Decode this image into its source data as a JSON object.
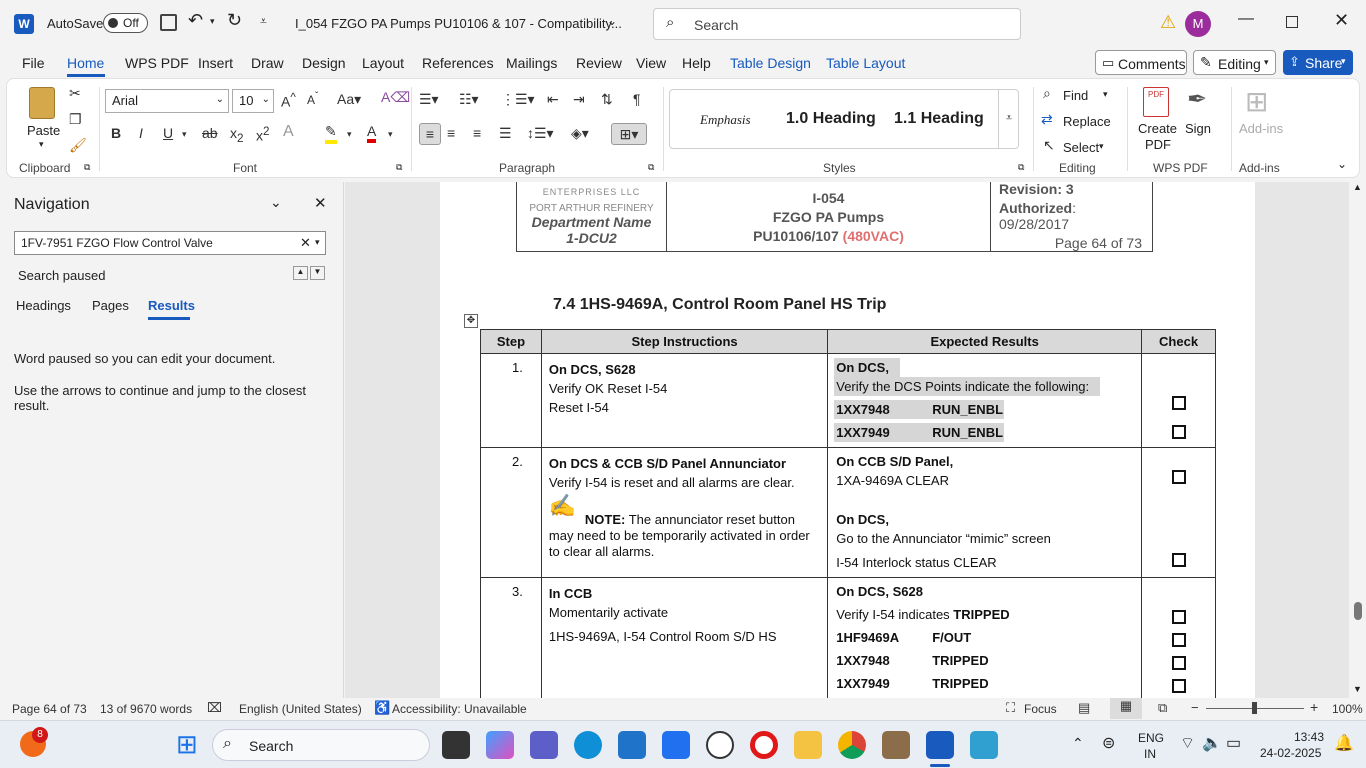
{
  "titlebar": {
    "autosave_label": "AutoSave",
    "autosave_state": "Off",
    "doc_title": "I_054 FZGO PA Pumps PU10106 & 107  -  Compatibility...",
    "search_placeholder": "Search",
    "avatar_letter": "M"
  },
  "tabs": [
    "File",
    "Home",
    "WPS PDF",
    "Insert",
    "Draw",
    "Design",
    "Layout",
    "References",
    "Mailings",
    "Review",
    "View",
    "Help",
    "Table Design",
    "Table Layout"
  ],
  "right_buttons": {
    "comments": "Comments",
    "editing": "Editing",
    "share": "Share"
  },
  "ribbon": {
    "clipboard": {
      "paste": "Paste",
      "group": "Clipboard"
    },
    "font": {
      "name": "Arial",
      "size": "10",
      "group": "Font"
    },
    "paragraph": {
      "group": "Paragraph"
    },
    "styles": {
      "group": "Styles",
      "items": [
        "Emphasis",
        "1.0  Heading",
        "1.1  Heading"
      ]
    },
    "editing": {
      "find": "Find",
      "replace": "Replace",
      "select": "Select",
      "group": "Editing"
    },
    "wps": {
      "create": "Create",
      "pdf": "PDF",
      "sign": "Sign",
      "group": "WPS PDF"
    },
    "addins": {
      "label": "Add-ins",
      "group": "Add-ins"
    }
  },
  "nav": {
    "title": "Navigation",
    "search_value": "1FV-7951 FZGO Flow Control Valve",
    "status": "Search paused",
    "tabs": [
      "Headings",
      "Pages",
      "Results"
    ],
    "msg1": "Word paused so you can edit your document.",
    "msg2": "Use the arrows to continue and jump to the closest result."
  },
  "doc": {
    "header": {
      "company": "ENTERPRISES LLC",
      "refinery": "PORT ARTHUR REFINERY",
      "dept": "Department Name",
      "unit": "1-DCU2",
      "doc_id": "I-054",
      "doc_name": "FZGO PA Pumps",
      "doc_pu": "PU10106/107",
      "doc_volt": "(480VAC)",
      "revision_label": "Revision:",
      "revision": "3",
      "auth_label": "Authorized",
      "auth_date": ": 09/28/2017",
      "page": "Page 64 of 73"
    },
    "section_title": "7.4  1HS-9469A, Control Room Panel HS Trip",
    "columns": [
      "Step",
      "Step Instructions",
      "Expected Results",
      "Check"
    ],
    "row1": {
      "num": "1.",
      "i1": "On DCS, S628",
      "i2": "Verify OK Reset I-54",
      "i3": "Reset I-54",
      "r1": "On DCS,",
      "r2": "Verify the DCS Points indicate the following:",
      "p1": "1XX7948",
      "v1": "RUN_ENBL",
      "p2": "1XX7949",
      "v2": "RUN_ENBL"
    },
    "row2": {
      "num": "2.",
      "i1": "On DCS & CCB S/D Panel Annunciator",
      "i2": "Verify I-54 is reset and all alarms are clear.",
      "note_label": "NOTE:",
      "note_text": " The annunciator reset button may need to be temporarily activated in order to clear all alarms.",
      "r1": "On CCB S/D Panel,",
      "r2": "1XA-9469A CLEAR",
      "r3": "On DCS,",
      "r4": "Go to the Annunciator “mimic” screen",
      "r5": "I-54 Interlock status CLEAR"
    },
    "row3": {
      "num": "3.",
      "i1": "In CCB",
      "i2": "Momentarily activate",
      "i3": "1HS-9469A, I-54 Control Room S/D HS",
      "r1a": "On DCS, ",
      "r1b": "S628",
      "r2a": "Verify I-54 indicates ",
      "r2b": "TRIPPED",
      "p1": "1HF9469A",
      "v1": "F/OUT",
      "p2": "1XX7948",
      "v2": "TRIPPED",
      "p3": "1XX7949",
      "v3": "TRIPPED"
    }
  },
  "status": {
    "page": "Page 64 of 73",
    "words": "13 of 9670 words",
    "language": "English (United States)",
    "accessibility": "Accessibility: Unavailable",
    "focus": "Focus",
    "zoom": "100%"
  },
  "taskbar": {
    "badge": "8",
    "search": "Search",
    "lang1": "ENG",
    "lang2": "IN",
    "time": "13:43",
    "date": "24-02-2025"
  },
  "colors": {
    "accent": "#185abd",
    "voltage": "#e07070",
    "share": "#185abd"
  }
}
